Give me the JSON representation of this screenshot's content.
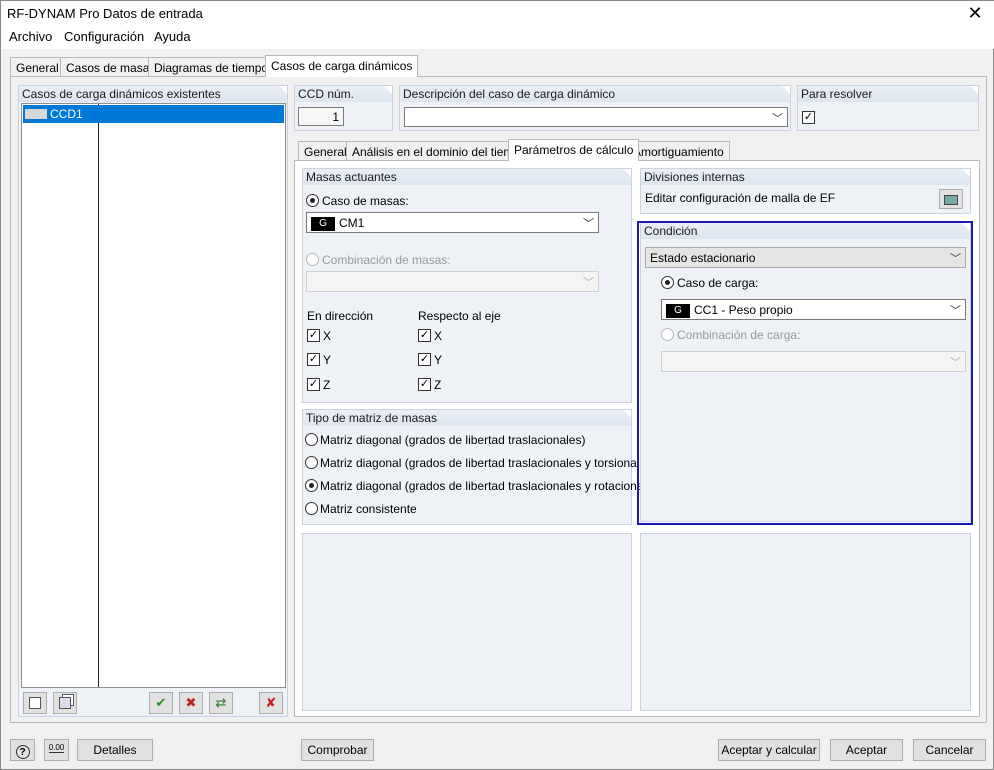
{
  "window": {
    "title": "RF-DYNAM Pro Datos de entrada"
  },
  "menu": [
    "Archivo",
    "Configuración",
    "Ayuda"
  ],
  "main_tabs": [
    "General",
    "Casos de masas",
    "Diagramas de tiempos",
    "Casos de carga dinámicos"
  ],
  "left_panel": {
    "header": "Casos de carga dinámicos existentes",
    "items": [
      {
        "label": "CCD1"
      }
    ]
  },
  "ccd": {
    "header": "CCD núm.",
    "value": "1"
  },
  "descripcion": {
    "header": "Descripción del caso de carga dinámico",
    "value": ""
  },
  "resolver": {
    "header": "Para resolver",
    "checked": true
  },
  "sub_tabs": [
    "General",
    "Análisis en el dominio del tiempo",
    "Parámetros de cálculo",
    "Amortiguamiento"
  ],
  "masas_actuantes": {
    "header": "Masas actuantes",
    "caso_label": "Caso de masas:",
    "caso_tag": "G",
    "caso_value": "CM1",
    "comb_label": "Combinación de masas:",
    "direccion_label": "En dirección",
    "eje_label": "Respecto al eje",
    "axes": [
      "X",
      "Y",
      "Z"
    ]
  },
  "tipo_matriz": {
    "header": "Tipo de matriz de masas",
    "options": [
      "Matriz diagonal (grados de libertad traslacionales)",
      "Matriz diagonal (grados de libertad traslacionales y torsionales)",
      "Matriz diagonal (grados de libertad traslacionales y rotacionales)",
      "Matriz consistente"
    ],
    "selected_index": 2
  },
  "divisiones": {
    "header": "Divisiones internas",
    "text": "Editar configuración de malla de EF"
  },
  "condicion": {
    "header": "Condición",
    "estado": "Estado estacionario",
    "caso_label": "Caso de carga:",
    "caso_tag": "G",
    "caso_value": "CC1 - Peso propio",
    "comb_label": "Combinación de carga:"
  },
  "bottom": {
    "detalles": "Detalles",
    "comprobar": "Comprobar",
    "aceptar_calcular": "Aceptar y calcular",
    "aceptar": "Aceptar",
    "cancelar": "Cancelar",
    "units_icon_text": "0.00"
  },
  "colors": {
    "selection": "#0078d7",
    "highlight": "#1a1ab0"
  }
}
